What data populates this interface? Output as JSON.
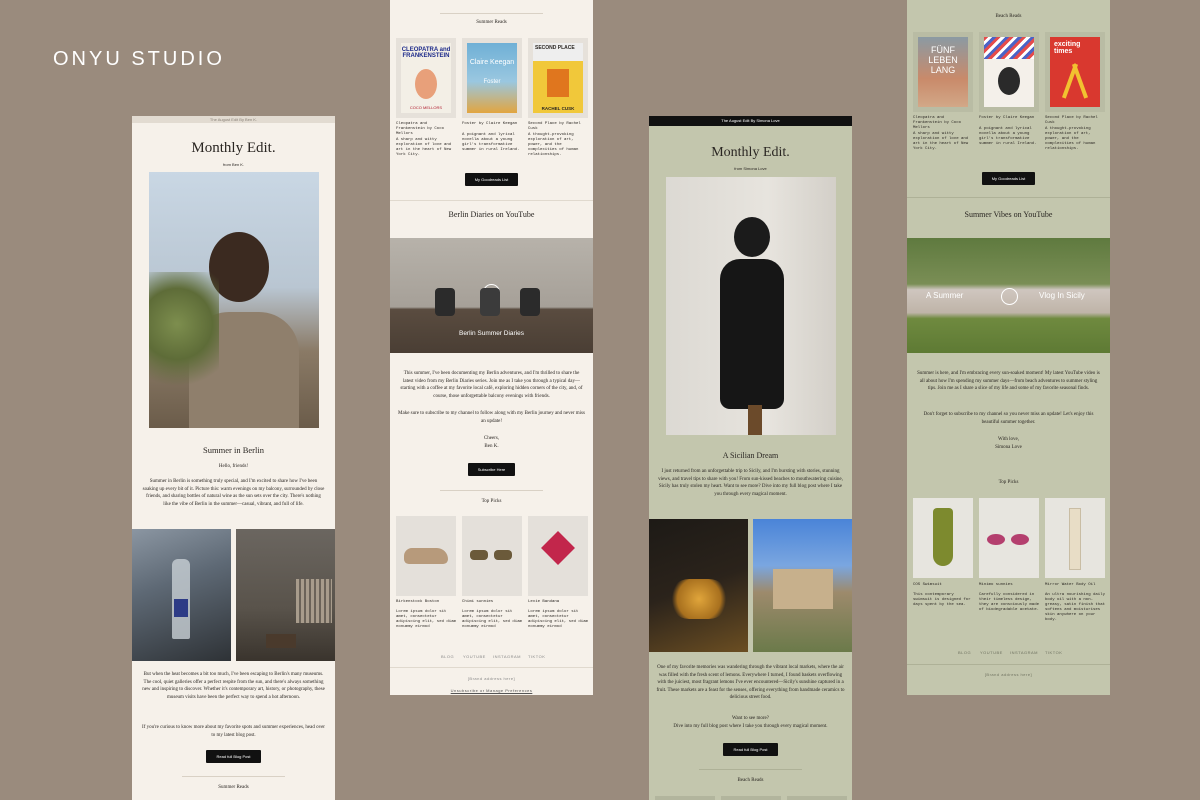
{
  "brand": "ONYU STUDIO",
  "p1": {
    "topbar": "The August Edit By Ben K.",
    "title": "Monthly Edit.",
    "from": "from Ben K.",
    "section": "Summer in Berlin",
    "greeting": "Hello, friends!",
    "body1": "Summer in Berlin is something truly special, and I'm excited to share how I've been soaking up every bit of it. Picture this: warm evenings on my balcony, surrounded by close friends, and sharing bottles of natural wine as the sun sets over the city. There's nothing like the vibe of Berlin in the summer—casual, vibrant, and full of life.",
    "body2": "But when the heat becomes a bit too much, I've been escaping to Berlin's many museums. The cool, quiet galleries offer a perfect respite from the sun, and there's always something new and inspiring to discover. Whether it's contemporary art, history, or photography, these museum visits have been the perfect way to spend a hot afternoon.",
    "body3": "If you're curious to know more about my favorite spots and summer experiences, head over to my latest blog post.",
    "button": "Read full Blog Post",
    "next": "Summer Reads"
  },
  "p2": {
    "heading": "Summer Reads",
    "books": [
      {
        "cover_title": "CLEOPATRA and FRANKENSTEIN",
        "cover_author": "COCO MELLORS",
        "title": "Cleopatra and Frankenstein by Coco Mellors",
        "desc": "A sharp and witty exploration of love and art in the heart of New York City."
      },
      {
        "cover_title": "Claire Keegan",
        "cover_author": "Foster",
        "title": "Foster by Claire Keegan",
        "desc": "A poignant and lyrical novella about a young girl's transformative summer in rural Ireland."
      },
      {
        "cover_title": "SECOND PLACE",
        "cover_author": "RACHEL CUSK",
        "title": "Second Place by Rachel Cusk",
        "desc": "A thought-provoking exploration of art, power, and the complexities of human relationships."
      }
    ],
    "goodreads": "My Goodreads List",
    "yt_heading": "Berlin Diaries on YouTube",
    "video_caption": "Berlin Summer Diaries",
    "body1": "This summer, I've been documenting my Berlin adventures, and I'm thrilled to share the latest video from my Berlin Diaries series. Join me as I take you through a typical day—starting with a coffee at my favorite local café, exploring hidden corners of the city, and, of course, those unforgettable balcony evenings with friends.",
    "body2": "Make sure to subscribe to my channel to follow along with my Berlin journey and never miss an update!",
    "signoff": "Cheers,",
    "signname": "Ben K.",
    "subscribe": "Subscribe Here",
    "picks_heading": "Top Picks",
    "picks": [
      {
        "name": "Birkenstock Boston",
        "desc": "Lorem ipsum dolor sit amet, consectetur adipiscing elit, sed diam nonummy eirmod"
      },
      {
        "name": "Chimi sunnies",
        "desc": "Lorem ipsum dolor sit amet, consectetur adipiscing elit, sed diam nonummy eirmod"
      },
      {
        "name": "Lexie Bandana",
        "desc": "Lorem ipsum dolor sit amet, consectetur adipiscing elit, sed diam nonummy eirmod"
      }
    ],
    "footer_links": [
      "BLOG",
      "YOUTUBE",
      "INSTAGRAM",
      "TIKTOK"
    ],
    "address": "[Brand address here]",
    "unsub": "Unsubscribe or Manage Preferences"
  },
  "p3": {
    "topbar": "The August Edit By Simona Love",
    "title": "Monthly Edit.",
    "from": "from Simona Love",
    "section": "A Sicilian Dream",
    "body1": "I just returned from an unforgettable trip to Sicily, and I'm bursting with stories, stunning views, and travel tips to share with you! From sun-kissed beaches to mouthwatering cuisine, Sicily has truly stolen my heart. Want to see more? Dive into my full blog post where I take you through every magical moment.",
    "body2": "One of my favorite memories was wandering through the vibrant local markets, where the air was filled with the fresh scent of lemons. Everywhere I turned, I found baskets overflowing with the juiciest, most fragrant lemons I've ever encountered—Sicily's sunshine captured in a fruit. These markets are a feast for the senses, offering everything from handmade ceramics to delicious street food.",
    "body3": "Want to see more?",
    "body4": "Dive into my full blog post where I take you through every magical moment.",
    "button": "Read full Blog Post",
    "next": "Beach Reads"
  },
  "p4": {
    "heading": "Beach Reads",
    "books": [
      {
        "cover_title": "FÜNF LEBEN LANG",
        "cover_author": "",
        "title": "Cleopatra and Frankenstein by Coco Mellors",
        "desc": "A sharp and witty exploration of love and art in the heart of New York City."
      },
      {
        "cover_title": "",
        "cover_author": "",
        "title": "Foster by Claire Keegan",
        "desc": "A poignant and lyrical novella about a young girl's transformative summer in rural Ireland."
      },
      {
        "cover_title": "exciting times",
        "cover_author": "",
        "title": "Second Place by Rachel Cusk",
        "desc": "A thought-provoking exploration of art, power, and the complexities of human relationships."
      }
    ],
    "goodreads": "My Goodreads List",
    "yt_heading": "Summer Vibes on YouTube",
    "video_left": "A Summer",
    "video_right": "Vlog In Sicily",
    "body1": "Summer is here, and I'm embracing every sun-soaked moment! My latest YouTube video is all about how I'm spending my summer days—from beach adventures to summer styling tips. Join me as I share a slice of my life and some of my favorite seasonal finds.",
    "body2": "Don't forget to subscribe to my channel so you never miss an update! Let's enjoy this beautiful summer together.",
    "signoff": "With love,",
    "signname": "Simona Love",
    "picks_heading": "Top Picks",
    "picks": [
      {
        "name": "COS Swimsuit",
        "desc": "This contemporary swimsuit is designed for days spent by the sea."
      },
      {
        "name": "Minimo sunnies",
        "desc": "Carefully considered in their timeless design, they are consciously made of biodegradable acetate."
      },
      {
        "name": "Mirror Water Body Oil",
        "desc": "An ultra nourishing daily body oil with a non-greasy, satin finish that softens and moisturises skin anywhere on your body."
      }
    ],
    "footer_links": [
      "BLOG",
      "YOUTUBE",
      "INSTAGRAM",
      "TIKTOK"
    ],
    "address": "[Brand address here]"
  }
}
